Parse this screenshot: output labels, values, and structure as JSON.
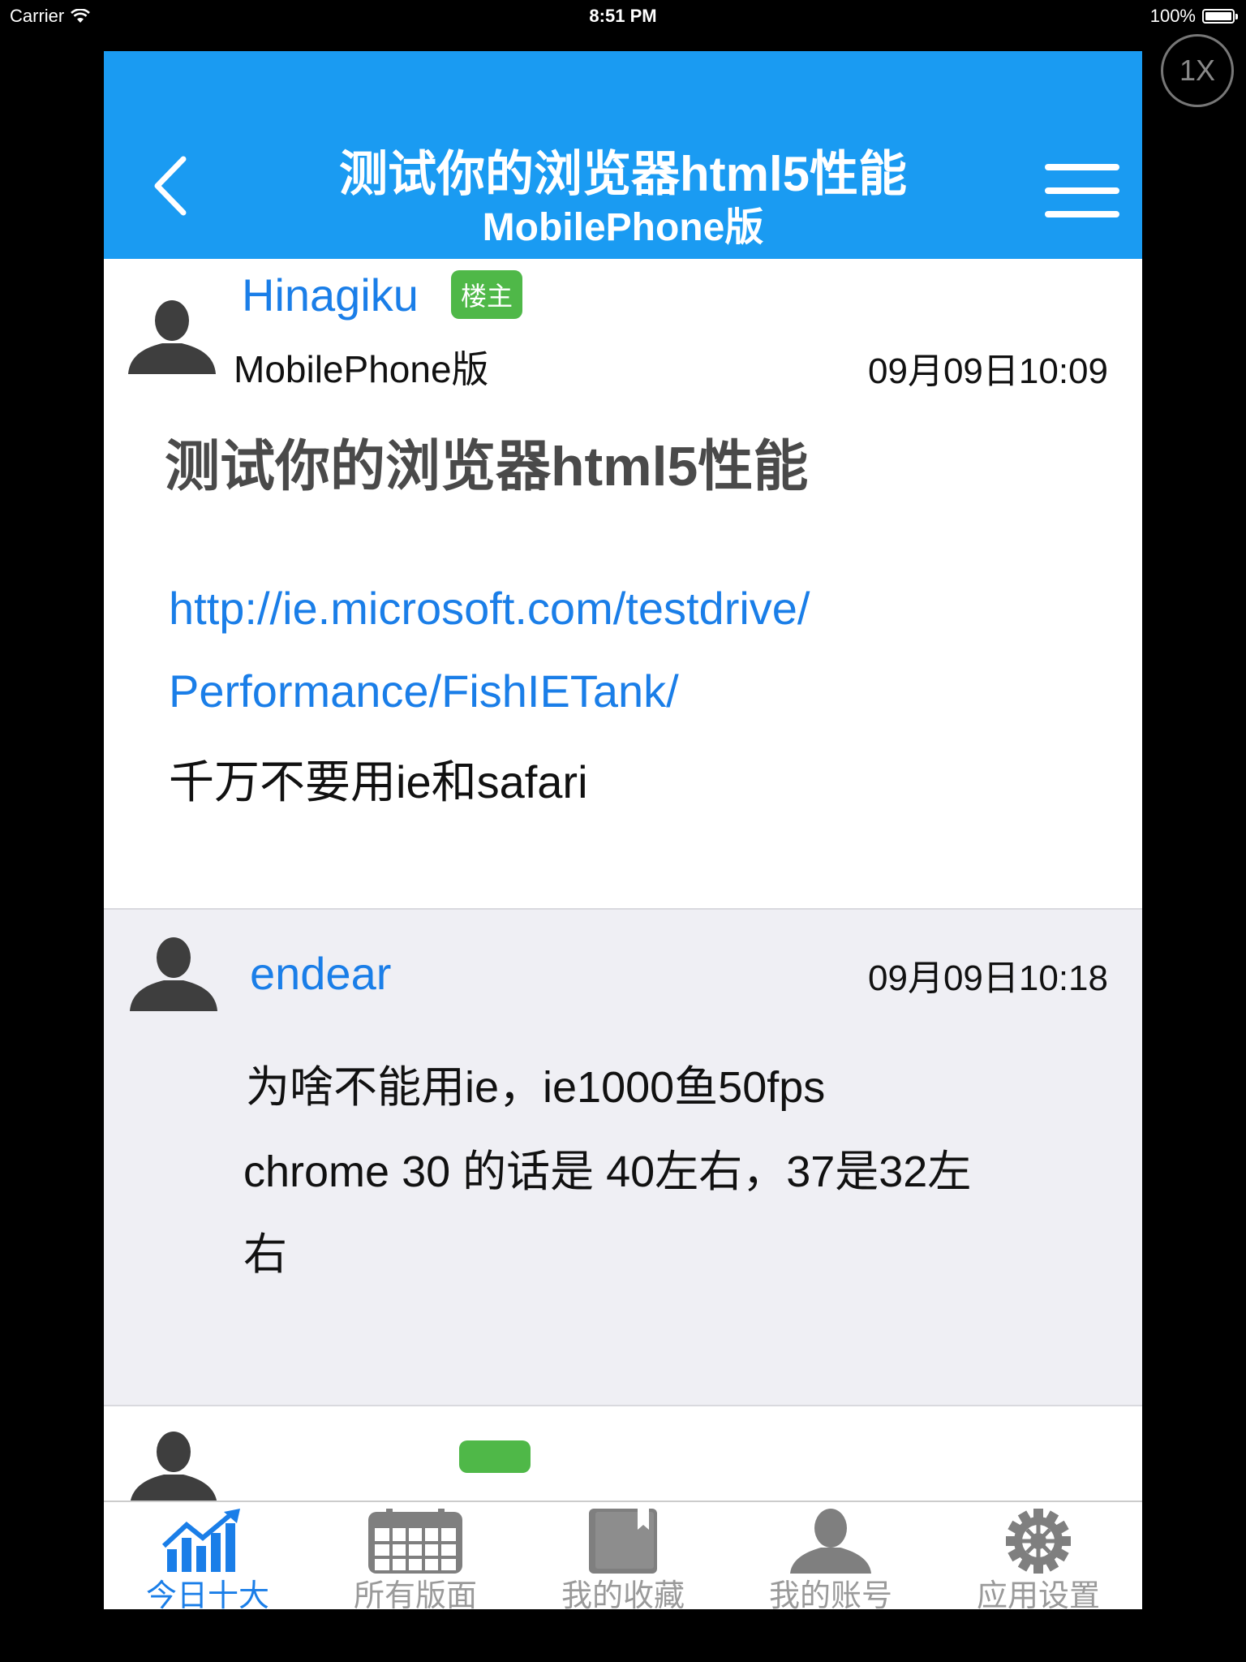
{
  "status_bar": {
    "carrier": "Carrier",
    "time": "8:51 PM",
    "battery": "100%"
  },
  "zoom_badge": "1X",
  "nav": {
    "title": "测试你的浏览器html5性能",
    "subtitle": "MobilePhone版"
  },
  "posts": [
    {
      "author": "Hinagiku",
      "badge": "楼主",
      "board": "MobilePhone版",
      "time": "09月09日10:09",
      "title": "测试你的浏览器html5性能",
      "link_line1": "http://ie.microsoft.com/testdrive/",
      "link_line2": "Performance/FishIETank/",
      "text": "千万不要用ie和safari"
    },
    {
      "author": "endear",
      "time": "09月09日10:18",
      "line1": "为啥不能用ie，ie1000鱼50fps",
      "line2": "chrome 30 的话是 40左右，37是32左",
      "line3": "右"
    }
  ],
  "tabs": [
    {
      "label": "今日十大",
      "icon": "chart-icon",
      "active": true
    },
    {
      "label": "所有版面",
      "icon": "calendar-icon",
      "active": false
    },
    {
      "label": "我的收藏",
      "icon": "book-icon",
      "active": false
    },
    {
      "label": "我的账号",
      "icon": "person-icon",
      "active": false
    },
    {
      "label": "应用设置",
      "icon": "gear-icon",
      "active": false
    }
  ],
  "colors": {
    "nav_bg": "#1a9bf2",
    "accent": "#1a7ee8",
    "badge": "#4fb848",
    "reply_bg": "#efeff4",
    "tab_inactive": "#9a9a9a"
  }
}
